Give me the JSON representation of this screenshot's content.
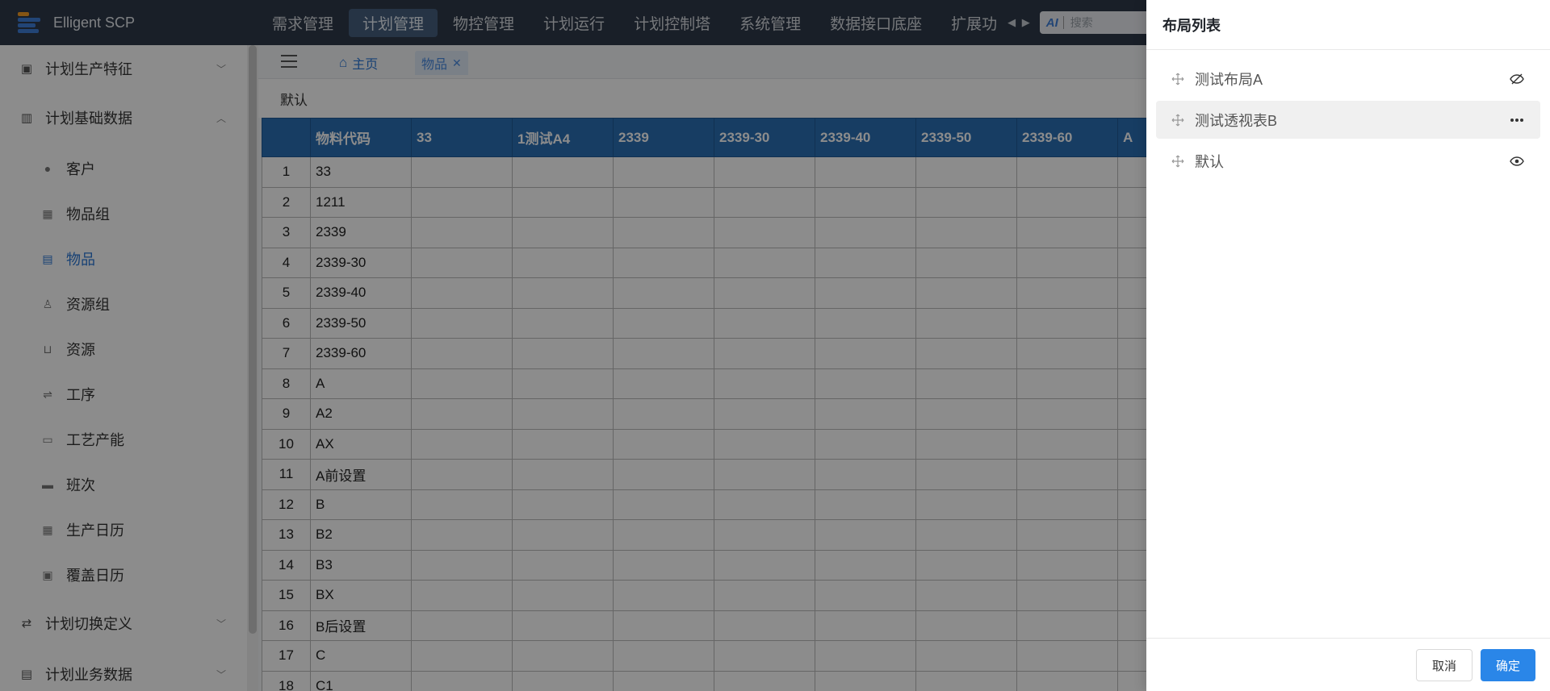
{
  "app": {
    "title": "Elligent SCP"
  },
  "topnav": {
    "items": [
      {
        "label": "需求管理",
        "active": false
      },
      {
        "label": "计划管理",
        "active": true
      },
      {
        "label": "物控管理",
        "active": false
      },
      {
        "label": "计划运行",
        "active": false
      },
      {
        "label": "计划控制塔",
        "active": false
      },
      {
        "label": "系统管理",
        "active": false
      },
      {
        "label": "数据接口底座",
        "active": false
      },
      {
        "label": "扩展功",
        "active": false
      }
    ],
    "search_ai": "AI",
    "search_placeholder": "搜索"
  },
  "sidebar": {
    "groups": [
      {
        "label": "计划生产特征",
        "icon": "clipboard-icon",
        "expanded": false
      },
      {
        "label": "计划基础数据",
        "icon": "building-icon",
        "expanded": true
      },
      {
        "label": "计划切换定义",
        "icon": "switch-arrows-icon",
        "expanded": false
      },
      {
        "label": "计划业务数据",
        "icon": "document-icon",
        "expanded": false
      }
    ],
    "items": [
      {
        "label": "客户",
        "icon": "customer-icon",
        "active": false
      },
      {
        "label": "物品组",
        "icon": "grid-icon",
        "active": false
      },
      {
        "label": "物品",
        "icon": "box-icon",
        "active": true
      },
      {
        "label": "资源组",
        "icon": "resource-group-icon",
        "active": false
      },
      {
        "label": "资源",
        "icon": "cart-icon",
        "active": false
      },
      {
        "label": "工序",
        "icon": "process-icon",
        "active": false
      },
      {
        "label": "工艺产能",
        "icon": "capacity-icon",
        "active": false
      },
      {
        "label": "班次",
        "icon": "shift-icon",
        "active": false
      },
      {
        "label": "生产日历",
        "icon": "calendar-icon",
        "active": false
      },
      {
        "label": "覆盖日历",
        "icon": "override-calendar-icon",
        "active": false
      }
    ]
  },
  "tabs": {
    "home": "主页",
    "current": "物品"
  },
  "layout_name": "默认",
  "table": {
    "columns": [
      "",
      "物料代码",
      "33",
      "1测试A4",
      "2339",
      "2339-30",
      "2339-40",
      "2339-50",
      "2339-60",
      "A"
    ],
    "rows": [
      {
        "num": "1",
        "code": "33"
      },
      {
        "num": "2",
        "code": "1211"
      },
      {
        "num": "3",
        "code": "2339"
      },
      {
        "num": "4",
        "code": "2339-30"
      },
      {
        "num": "5",
        "code": "2339-40"
      },
      {
        "num": "6",
        "code": "2339-50"
      },
      {
        "num": "7",
        "code": "2339-60"
      },
      {
        "num": "8",
        "code": "A"
      },
      {
        "num": "9",
        "code": "A2"
      },
      {
        "num": "10",
        "code": "AX"
      },
      {
        "num": "11",
        "code": "A前设置"
      },
      {
        "num": "12",
        "code": "B"
      },
      {
        "num": "13",
        "code": "B2"
      },
      {
        "num": "14",
        "code": "B3"
      },
      {
        "num": "15",
        "code": "BX"
      },
      {
        "num": "16",
        "code": "B后设置"
      },
      {
        "num": "17",
        "code": "C"
      },
      {
        "num": "18",
        "code": "C1"
      }
    ]
  },
  "drawer": {
    "title": "布局列表",
    "layouts": [
      {
        "label": "测试布局A",
        "action_icon": "eye-off-icon"
      },
      {
        "label": "测试透视表B",
        "action_icon": "more-icon",
        "hover": true
      },
      {
        "label": "默认",
        "action_icon": "eye-icon"
      }
    ],
    "cancel_label": "取消",
    "ok_label": "确定"
  },
  "colors": {
    "topbar_bg": "#2f3a4a",
    "accent": "#2a77d6",
    "header_bg": "#2a6fb4",
    "primary_button": "#2a86e8"
  }
}
